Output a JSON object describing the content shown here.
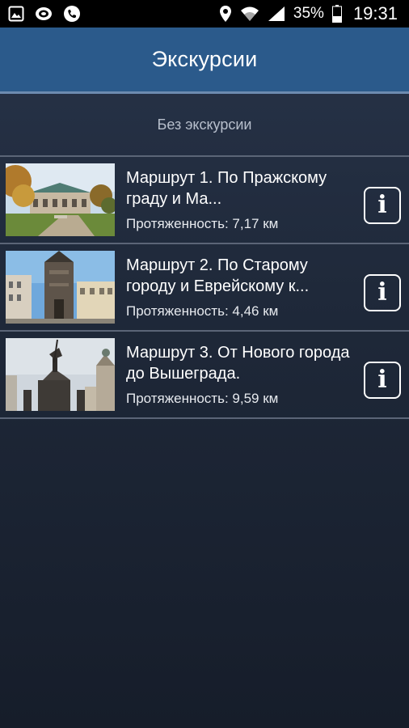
{
  "status_bar": {
    "battery": "35%",
    "time": "19:31",
    "icons": [
      "gallery-icon",
      "cast-icon",
      "phone-icon",
      "location-icon",
      "wifi-icon",
      "signal-icon",
      "battery-icon"
    ]
  },
  "app_bar": {
    "title": "Экскурсии"
  },
  "no_tour": {
    "label": "Без экскурсии"
  },
  "routes": [
    {
      "title": "Маршрут 1. По Пражскому граду и Ма...",
      "length_label": "Протяженность:",
      "length_value": "7,17 км",
      "image": "prague-castle-garden-photo"
    },
    {
      "title": "Маршрут 2. По Старому городу и Еврейскому к...",
      "length_label": "Протяженность:",
      "length_value": "4,46 км",
      "image": "powder-tower-photo"
    },
    {
      "title": "Маршрут 3. От Нового города до Вышеграда.",
      "length_label": "Протяженность:",
      "length_value": "9,59 км",
      "image": "wenceslas-statue-photo"
    }
  ],
  "info_icon": "info-icon",
  "colors": {
    "app_bar": "#2b5a8b",
    "background": "#1e2738",
    "divider": "#5b6577"
  }
}
